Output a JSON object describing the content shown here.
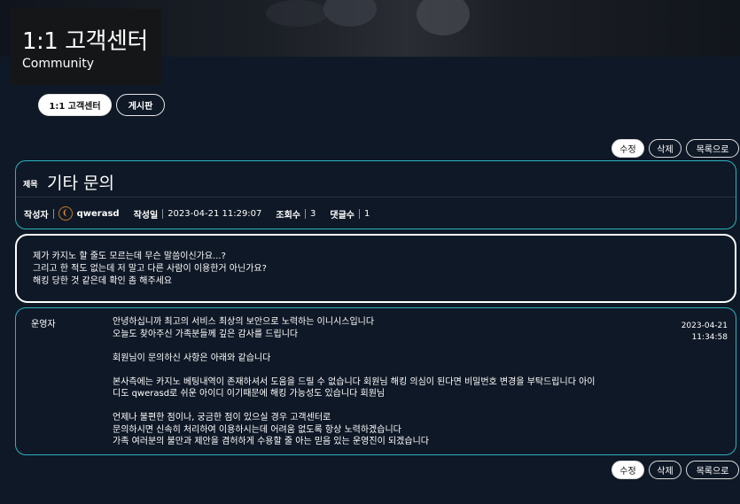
{
  "header": {
    "title": "1:1 고객센터",
    "subtitle": "Community"
  },
  "tabs": [
    {
      "label": "1:1 고객센터",
      "active": true
    },
    {
      "label": "게시판",
      "active": false
    }
  ],
  "actions": {
    "edit_label": "수정",
    "delete_label": "삭제",
    "list_label": "목록으로"
  },
  "post": {
    "title_label": "제목",
    "title": "기타 문의",
    "author_label": "작성자",
    "author": "qwerasd",
    "avatar_icon": "level-badge-icon",
    "date_label": "작성일",
    "date": "2023-04-21 11:29:07",
    "views_label": "조회수",
    "views": "3",
    "comments_label": "댓글수",
    "comments": "1",
    "body": [
      "제가 카지노 할 줄도 모르는데 무슨 말씀이신가요...?",
      "그리고 한 적도 없는데 저 말고 다른 사람이 이용한거 아닌가요?",
      "해킹 당한 것 같은데 확인 좀 해주세요"
    ]
  },
  "reply": {
    "author": "운영자",
    "paragraphs": [
      "안녕하십니까 최고의 서비스 최상의 보안으로 노력하는 이니시스입니다\n오늘도 찾아주신 가족분들께 깊은 감사를 드립니다",
      "회원님이 문의하신 사항은 아래와 같습니다",
      "본사측에는 카지노 베팅내역이 존재하셔서 도움을 드릴 수 없습니다 회원님 해킹 의심이 된다면 비밀번호 변경을 부탁드립니다 아이\n디도 qwerasd로 쉬운 아이디 이기때문에 해킹 가능성도 있습니다 회원님",
      "언제나 불편한 점이나, 궁금한 점이 있으실 경우 고객센터로\n문의하시면 신속히 처리하여 이용하시는데 어려움 없도록 항상 노력하겠습니다\n가족 여러분의 불만과 제안을 겸허하게 수용할 줄 아는 믿음 있는 운영진이 되겠습니다"
    ],
    "date": "2023-04-21",
    "time": "11:34:58"
  }
}
